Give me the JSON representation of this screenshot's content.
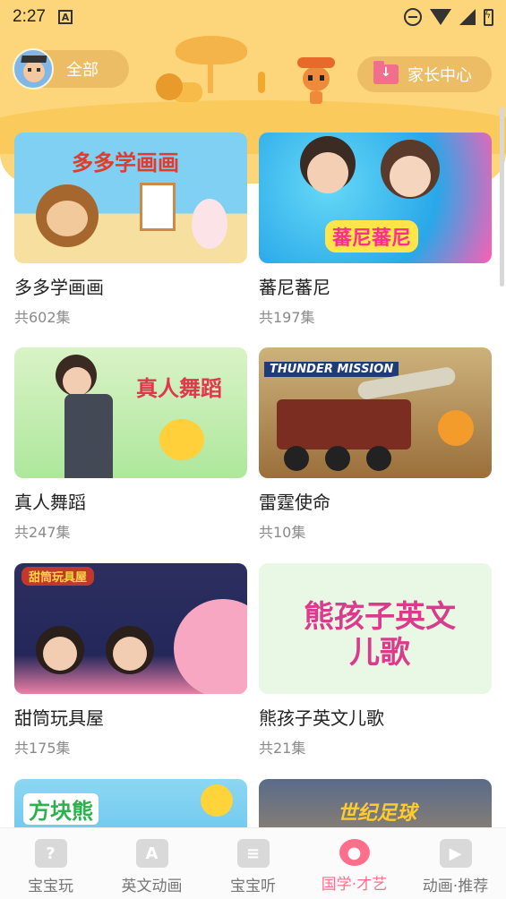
{
  "status_bar": {
    "time": "2:27",
    "notif_label": "A"
  },
  "header": {
    "category_label": "全部",
    "parent_center_label": "家长中心"
  },
  "cards": [
    {
      "title": "多多学画画",
      "count": "共602集",
      "thumb_text": "多多学画画"
    },
    {
      "title": "蕃尼蕃尼",
      "count": "共197集",
      "thumb_text": "蕃尼蕃尼"
    },
    {
      "title": "真人舞蹈",
      "count": "共247集",
      "thumb_text": "真人舞蹈"
    },
    {
      "title": "雷霆使命",
      "count": "共10集",
      "thumb_text": "THUNDER MISSION"
    },
    {
      "title": "甜筒玩具屋",
      "count": "共175集",
      "thumb_text": "甜筒玩具屋"
    },
    {
      "title": "熊孩子英文儿歌",
      "count": "共21集",
      "thumb_text": "熊孩子英文儿歌"
    },
    {
      "title": "",
      "count": "",
      "thumb_text": "方块熊"
    },
    {
      "title": "",
      "count": "",
      "thumb_text": "世纪足球"
    }
  ],
  "bottom_nav": [
    {
      "label": "宝宝玩",
      "icon": "question-card-icon",
      "active": false
    },
    {
      "label": "英文动画",
      "icon": "letter-a-icon",
      "active": false
    },
    {
      "label": "宝宝听",
      "icon": "radio-icon",
      "active": false
    },
    {
      "label": "国学·才艺",
      "icon": "paw-icon",
      "active": true
    },
    {
      "label": "动画·推荐",
      "icon": "tv-icon",
      "active": false
    }
  ],
  "colors": {
    "header_bg": "#fdd67c",
    "active_tab": "#ff6f8c"
  }
}
